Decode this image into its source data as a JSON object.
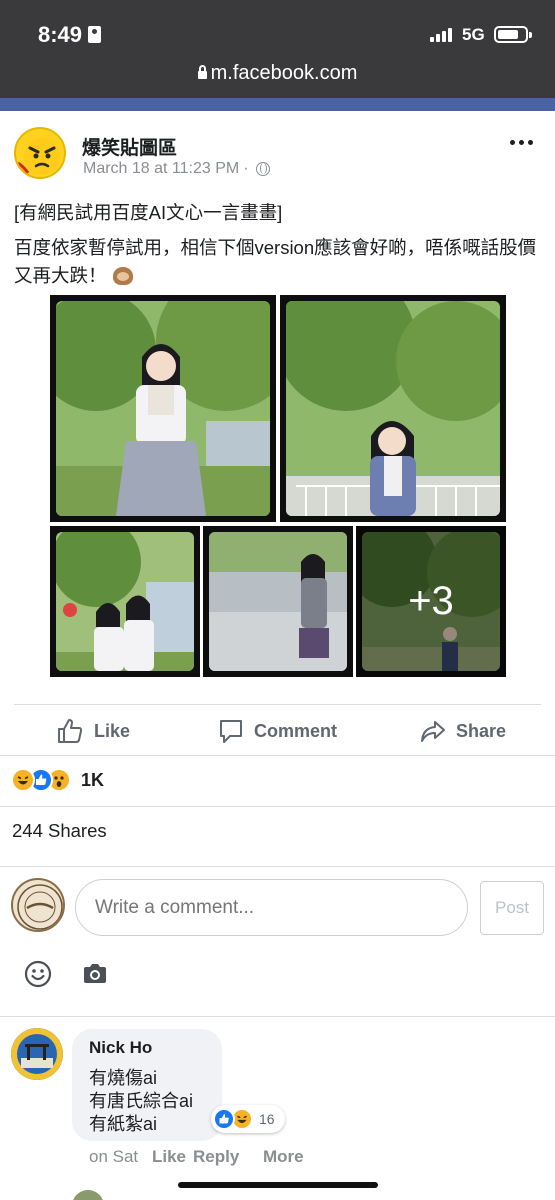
{
  "status_bar": {
    "time": "8:49",
    "network": "5G"
  },
  "browser": {
    "url": "m.facebook.com"
  },
  "post": {
    "page_name": "爆笑貼圖區",
    "timestamp": "March 18 at 11:23 PM",
    "meta_separator": "·",
    "text_line1": "[有網民試用百度AI文心一言畫畫]",
    "text_line2": "百度依家暫停試用，相信下個version應該會好啲，唔係嘅話股價又再大跌！",
    "more_photos_label": "+3"
  },
  "actions": {
    "like": "Like",
    "comment": "Comment",
    "share": "Share"
  },
  "reactions": {
    "icons": [
      "haha-icon",
      "like-icon",
      "wow-icon"
    ],
    "count": "1K"
  },
  "shares_text": "244 Shares",
  "composer": {
    "placeholder": "Write a comment...",
    "post_label": "Post"
  },
  "comment": {
    "author": "Nick Ho",
    "lines": [
      "有燒傷ai",
      "有唐氏綜合ai",
      "有紙紮ai"
    ],
    "reaction_count": "16",
    "time": "on Sat",
    "like_label": "Like",
    "reply_label": "Reply",
    "more_label": "More"
  },
  "colors": {
    "status_bg": "#3a3a3c",
    "fb_blue": "#4a63a4",
    "like_blue": "#1877f2",
    "reaction_yellow": "#f7b125",
    "muted_text": "#8a8d91",
    "action_text": "#606770"
  }
}
